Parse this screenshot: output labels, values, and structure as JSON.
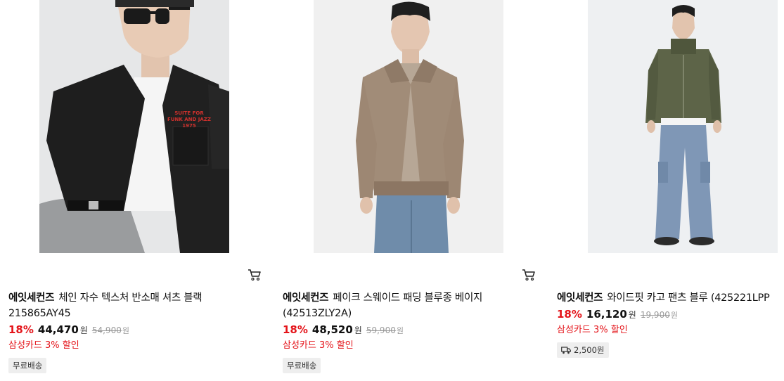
{
  "products": [
    {
      "brand": "에잇세컨즈",
      "name": "체인 자수 텍스처 반소매 셔츠 블랙 215865AY45",
      "discount_rate": "18%",
      "sale_price": "44,470",
      "currency": "원",
      "original_price": "54,900",
      "original_currency": "원",
      "promo": "삼성카드 3% 할인",
      "badge": "무료배송",
      "cart_icon": "cart-icon",
      "embroidery": "SUITE FOR\nFUNK AND JAZZ\n1975"
    },
    {
      "brand": "에잇세컨즈",
      "name": "페이크 스웨이드 패딩 블루종 베이지 (42513ZLY2A)",
      "discount_rate": "18%",
      "sale_price": "48,520",
      "currency": "원",
      "original_price": "59,900",
      "original_currency": "원",
      "promo": "삼성카드 3% 할인",
      "badge": "무료배송",
      "cart_icon": "cart-icon"
    },
    {
      "brand": "에잇세컨즈",
      "name": "와이드핏 카고 팬츠 블루 (425221LPP",
      "discount_rate": "18%",
      "sale_price": "16,120",
      "currency": "원",
      "original_price": "19,900",
      "original_currency": "원",
      "promo": "삼성카드 3% 할인",
      "badge": "2,500원",
      "badge_icon": "truck-icon"
    }
  ],
  "colors": {
    "accent_red": "#e4141a",
    "badge_bg": "#eeeeee"
  }
}
